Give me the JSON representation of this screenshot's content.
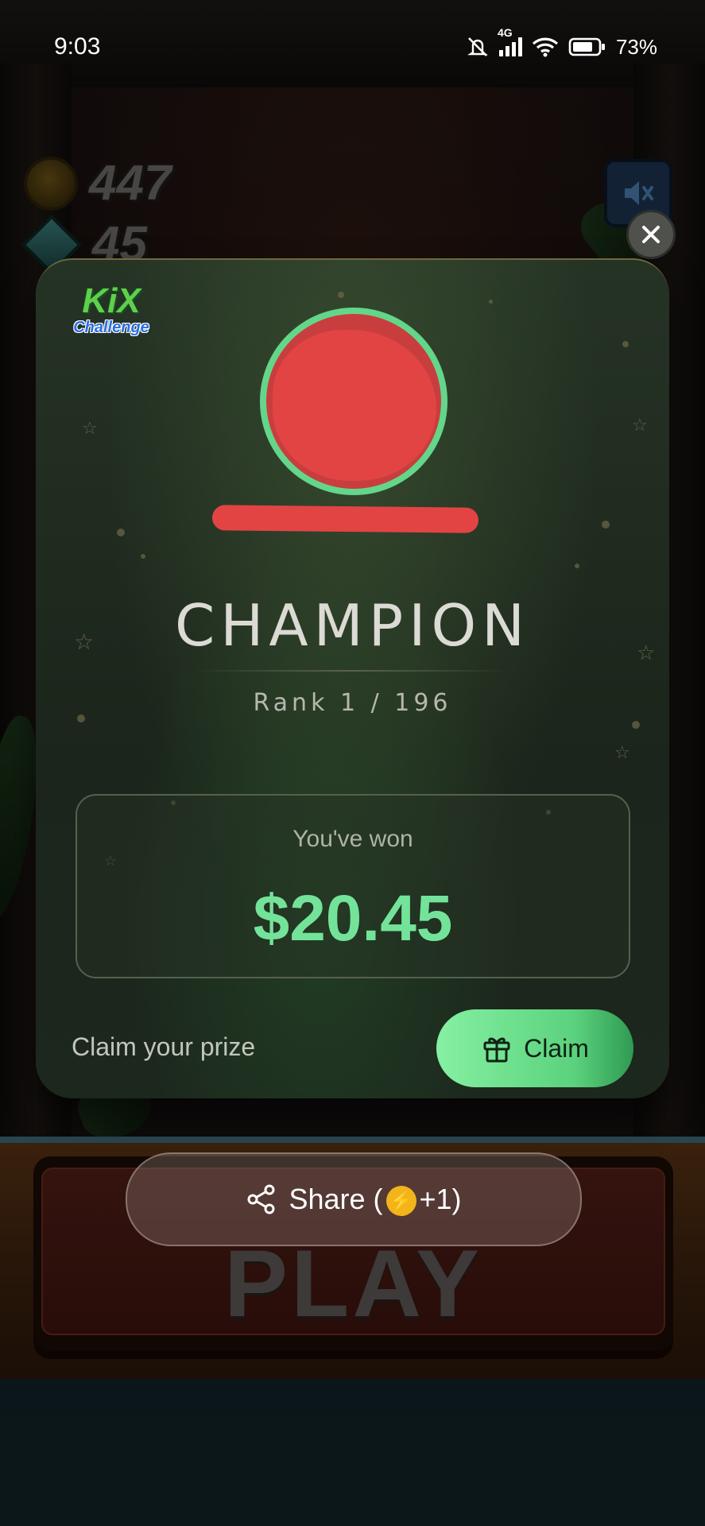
{
  "status_bar": {
    "time": "9:03",
    "network": "4G",
    "battery": "73%",
    "icons": [
      "mute-icon",
      "signal-icon",
      "wifi-icon",
      "battery-icon"
    ]
  },
  "hud": {
    "coins": "447",
    "gems": "45",
    "coin_icon": "coin-icon",
    "gem_icon": "gem-icon",
    "sound_icon": "speaker-muted-icon"
  },
  "game": {
    "play_label": "PLAY"
  },
  "modal": {
    "logo_top": "KiX",
    "logo_bottom": "Challenge",
    "title": "CHAMPION",
    "rank": "Rank 1 / 196",
    "won_label": "You've won",
    "won_amount": "$20.45",
    "claim_prompt": "Claim your prize",
    "claim_button": "Claim",
    "close_icon": "close-icon",
    "accent_color": "#74e39a"
  },
  "share": {
    "label": "Share (",
    "bonus": "+1)",
    "icon": "share-icon",
    "bonus_icon": "lightning-icon"
  }
}
